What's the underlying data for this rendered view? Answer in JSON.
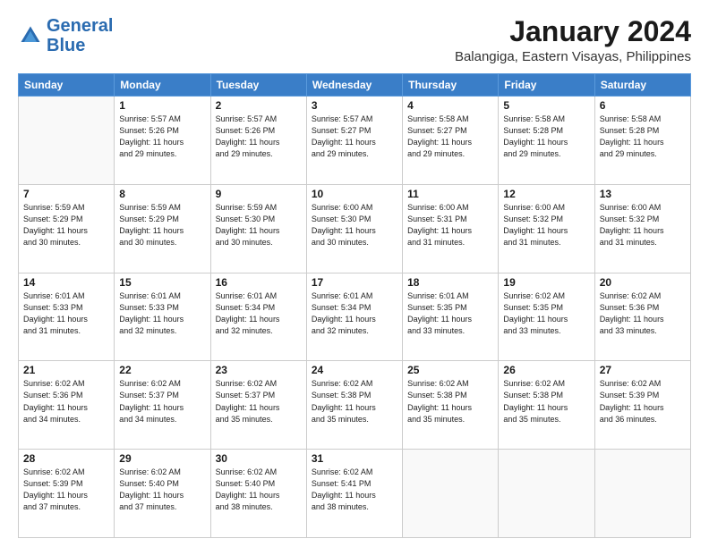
{
  "header": {
    "logo_line1": "General",
    "logo_line2": "Blue",
    "month_year": "January 2024",
    "location": "Balangiga, Eastern Visayas, Philippines"
  },
  "weekdays": [
    "Sunday",
    "Monday",
    "Tuesday",
    "Wednesday",
    "Thursday",
    "Friday",
    "Saturday"
  ],
  "weeks": [
    [
      {
        "day": "",
        "info": ""
      },
      {
        "day": "1",
        "info": "Sunrise: 5:57 AM\nSunset: 5:26 PM\nDaylight: 11 hours\nand 29 minutes."
      },
      {
        "day": "2",
        "info": "Sunrise: 5:57 AM\nSunset: 5:26 PM\nDaylight: 11 hours\nand 29 minutes."
      },
      {
        "day": "3",
        "info": "Sunrise: 5:57 AM\nSunset: 5:27 PM\nDaylight: 11 hours\nand 29 minutes."
      },
      {
        "day": "4",
        "info": "Sunrise: 5:58 AM\nSunset: 5:27 PM\nDaylight: 11 hours\nand 29 minutes."
      },
      {
        "day": "5",
        "info": "Sunrise: 5:58 AM\nSunset: 5:28 PM\nDaylight: 11 hours\nand 29 minutes."
      },
      {
        "day": "6",
        "info": "Sunrise: 5:58 AM\nSunset: 5:28 PM\nDaylight: 11 hours\nand 29 minutes."
      }
    ],
    [
      {
        "day": "7",
        "info": "Sunrise: 5:59 AM\nSunset: 5:29 PM\nDaylight: 11 hours\nand 30 minutes."
      },
      {
        "day": "8",
        "info": "Sunrise: 5:59 AM\nSunset: 5:29 PM\nDaylight: 11 hours\nand 30 minutes."
      },
      {
        "day": "9",
        "info": "Sunrise: 5:59 AM\nSunset: 5:30 PM\nDaylight: 11 hours\nand 30 minutes."
      },
      {
        "day": "10",
        "info": "Sunrise: 6:00 AM\nSunset: 5:30 PM\nDaylight: 11 hours\nand 30 minutes."
      },
      {
        "day": "11",
        "info": "Sunrise: 6:00 AM\nSunset: 5:31 PM\nDaylight: 11 hours\nand 31 minutes."
      },
      {
        "day": "12",
        "info": "Sunrise: 6:00 AM\nSunset: 5:32 PM\nDaylight: 11 hours\nand 31 minutes."
      },
      {
        "day": "13",
        "info": "Sunrise: 6:00 AM\nSunset: 5:32 PM\nDaylight: 11 hours\nand 31 minutes."
      }
    ],
    [
      {
        "day": "14",
        "info": "Sunrise: 6:01 AM\nSunset: 5:33 PM\nDaylight: 11 hours\nand 31 minutes."
      },
      {
        "day": "15",
        "info": "Sunrise: 6:01 AM\nSunset: 5:33 PM\nDaylight: 11 hours\nand 32 minutes."
      },
      {
        "day": "16",
        "info": "Sunrise: 6:01 AM\nSunset: 5:34 PM\nDaylight: 11 hours\nand 32 minutes."
      },
      {
        "day": "17",
        "info": "Sunrise: 6:01 AM\nSunset: 5:34 PM\nDaylight: 11 hours\nand 32 minutes."
      },
      {
        "day": "18",
        "info": "Sunrise: 6:01 AM\nSunset: 5:35 PM\nDaylight: 11 hours\nand 33 minutes."
      },
      {
        "day": "19",
        "info": "Sunrise: 6:02 AM\nSunset: 5:35 PM\nDaylight: 11 hours\nand 33 minutes."
      },
      {
        "day": "20",
        "info": "Sunrise: 6:02 AM\nSunset: 5:36 PM\nDaylight: 11 hours\nand 33 minutes."
      }
    ],
    [
      {
        "day": "21",
        "info": "Sunrise: 6:02 AM\nSunset: 5:36 PM\nDaylight: 11 hours\nand 34 minutes."
      },
      {
        "day": "22",
        "info": "Sunrise: 6:02 AM\nSunset: 5:37 PM\nDaylight: 11 hours\nand 34 minutes."
      },
      {
        "day": "23",
        "info": "Sunrise: 6:02 AM\nSunset: 5:37 PM\nDaylight: 11 hours\nand 35 minutes."
      },
      {
        "day": "24",
        "info": "Sunrise: 6:02 AM\nSunset: 5:38 PM\nDaylight: 11 hours\nand 35 minutes."
      },
      {
        "day": "25",
        "info": "Sunrise: 6:02 AM\nSunset: 5:38 PM\nDaylight: 11 hours\nand 35 minutes."
      },
      {
        "day": "26",
        "info": "Sunrise: 6:02 AM\nSunset: 5:38 PM\nDaylight: 11 hours\nand 35 minutes."
      },
      {
        "day": "27",
        "info": "Sunrise: 6:02 AM\nSunset: 5:39 PM\nDaylight: 11 hours\nand 36 minutes."
      }
    ],
    [
      {
        "day": "28",
        "info": "Sunrise: 6:02 AM\nSunset: 5:39 PM\nDaylight: 11 hours\nand 37 minutes."
      },
      {
        "day": "29",
        "info": "Sunrise: 6:02 AM\nSunset: 5:40 PM\nDaylight: 11 hours\nand 37 minutes."
      },
      {
        "day": "30",
        "info": "Sunrise: 6:02 AM\nSunset: 5:40 PM\nDaylight: 11 hours\nand 38 minutes."
      },
      {
        "day": "31",
        "info": "Sunrise: 6:02 AM\nSunset: 5:41 PM\nDaylight: 11 hours\nand 38 minutes."
      },
      {
        "day": "",
        "info": ""
      },
      {
        "day": "",
        "info": ""
      },
      {
        "day": "",
        "info": ""
      }
    ]
  ]
}
